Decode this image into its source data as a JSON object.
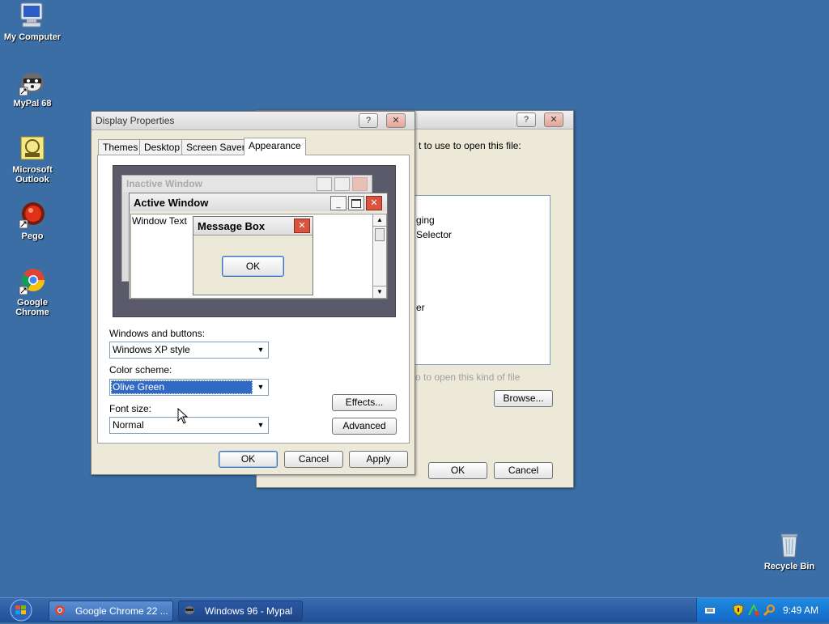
{
  "desktop": {
    "icons": [
      {
        "label": "My Computer",
        "icon": "my-computer-icon"
      },
      {
        "label": "MyPal 68",
        "icon": "mypal-icon"
      },
      {
        "label": "Microsoft Outlook",
        "icon": "outlook-icon"
      },
      {
        "label": "Pego",
        "icon": "pego-icon"
      },
      {
        "label": "Google Chrome",
        "icon": "chrome-icon"
      },
      {
        "label": "Recycle Bin",
        "icon": "recycle-bin-icon"
      }
    ]
  },
  "back_dialog": {
    "text1": "t to use to open this file:",
    "list": [
      "ging",
      "Selector",
      "er"
    ],
    "hint": "o to open this kind of file",
    "browse_label": "Browse...",
    "ok_label": "OK",
    "cancel_label": "Cancel",
    "help_glyph": "?",
    "close_glyph": "✕"
  },
  "display_props": {
    "title": "Display Properties",
    "help_glyph": "?",
    "close_glyph": "✕",
    "tabs": [
      "Themes",
      "Desktop",
      "Screen Saver",
      "Appearance"
    ],
    "active_tab": "Appearance",
    "preview": {
      "inactive_title": "Inactive Window",
      "active_title": "Active Window",
      "window_text": "Window Text",
      "message_box_title": "Message Box",
      "message_box_ok": "OK"
    },
    "windows_buttons_label": "Windows and buttons:",
    "windows_buttons_value": "Windows XP style",
    "color_scheme_label": "Color scheme:",
    "color_scheme_value": "Olive Green",
    "font_size_label": "Font size:",
    "font_size_value": "Normal",
    "effects_label": "Effects...",
    "advanced_label": "Advanced",
    "ok_label": "OK",
    "cancel_label": "Cancel",
    "apply_label": "Apply"
  },
  "taskbar": {
    "tasks": [
      {
        "label": "Google Chrome 22 ...",
        "icon": "chrome-icon"
      },
      {
        "label": "Windows 96 - Mypal",
        "icon": "mypal-icon"
      }
    ],
    "clock": "9:49 AM",
    "tray_icons": [
      "keyboard-icon",
      "security-shield-icon",
      "network-icon",
      "search-icon"
    ]
  },
  "colors": {
    "desktop": "#3a6ea5",
    "selection": "#316ac5",
    "taskbar": "#245edb"
  }
}
